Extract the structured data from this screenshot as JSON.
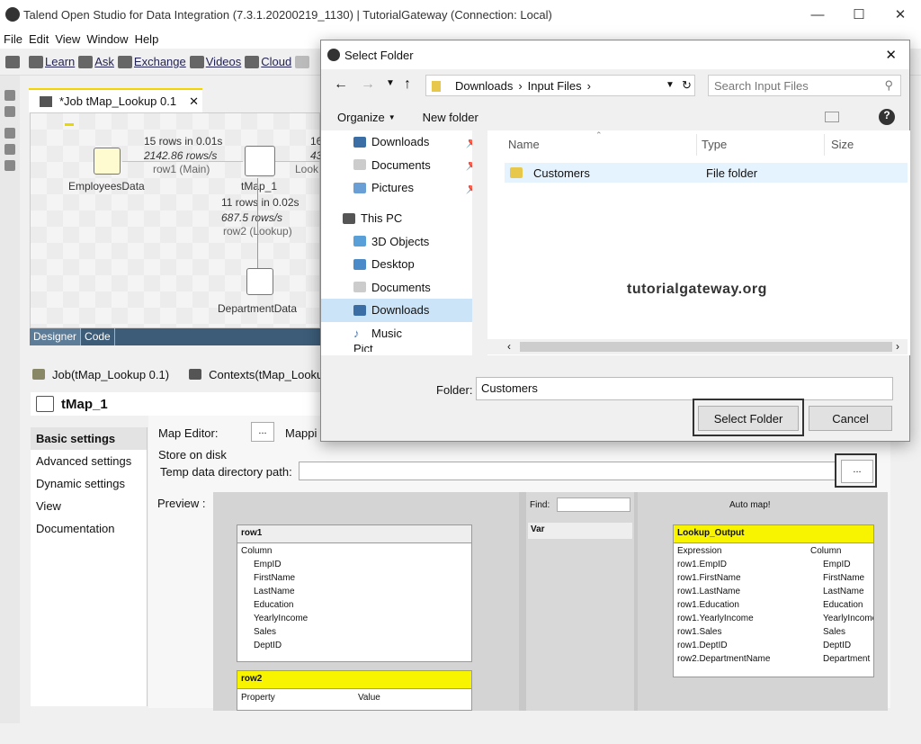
{
  "app": {
    "title": "Talend Open Studio for Data Integration (7.3.1.20200219_1130) | TutorialGateway (Connection: Local)",
    "menu": [
      "File",
      "Edit",
      "View",
      "Window",
      "Help"
    ],
    "toolbar": [
      "Learn",
      "Ask",
      "Exchange",
      "Videos",
      "Cloud"
    ]
  },
  "editor": {
    "tab_label": "*Job tMap_Lookup 0.1",
    "nodes": {
      "employees": "EmployeesData",
      "tmap": "tMap_1",
      "department": "DepartmentData"
    },
    "flows": {
      "main_stats": "15 rows in 0.01s",
      "main_rate": "2142.86 rows/s",
      "main_label": "row1 (Main)",
      "lookup_stats": "11 rows in 0.02s",
      "lookup_rate": "687.5 rows/s",
      "lookup_label": "row2 (Lookup)",
      "out_stats": "16",
      "out_rate": "43",
      "out_label": "Look"
    },
    "bottom_tabs": [
      "Designer",
      "Code"
    ]
  },
  "component_panel": {
    "job_tab": "Job(tMap_Lookup 0.1)",
    "contexts_tab": "Contexts(tMap_Looku",
    "title": "tMap_1",
    "left_tabs": [
      "Basic settings",
      "Advanced settings",
      "Dynamic settings",
      "View",
      "Documentation"
    ],
    "map_editor_label": "Map Editor:",
    "map_editor_btn": "...",
    "mapping_label": "Mappi",
    "store_label": "Store on disk",
    "temp_label": "Temp data directory path:",
    "temp_btn": "...",
    "preview_label": "Preview :"
  },
  "preview": {
    "row1": {
      "title": "row1",
      "header": "Column",
      "columns": [
        "EmpID",
        "FirstName",
        "LastName",
        "Education",
        "YearlyIncome",
        "Sales",
        "DeptID"
      ]
    },
    "row2": {
      "title": "row2",
      "col1": "Property",
      "col2": "Value"
    },
    "var": {
      "title": "Var",
      "find_label": "Find:"
    },
    "output": {
      "auto_map": "Auto map!",
      "title": "Lookup_Output",
      "expr_header": "Expression",
      "col_header": "Column",
      "expressions": [
        "row1.EmpID",
        "row1.FirstName",
        "row1.LastName",
        "row1.Education",
        "row1.YearlyIncome",
        "row1.Sales",
        "row1.DeptID",
        "row2.DepartmentName"
      ],
      "columns": [
        "EmpID",
        "FirstName",
        "LastName",
        "Education",
        "YearlyIncome",
        "Sales",
        "DeptID",
        "Department"
      ]
    }
  },
  "dialog": {
    "title": "Select Folder",
    "path": [
      "Downloads",
      "Input Files"
    ],
    "search_placeholder": "Search Input Files",
    "organize": "Organize",
    "new_folder": "New folder",
    "nav_quick": [
      "Downloads",
      "Documents",
      "Pictures"
    ],
    "this_pc": "This PC",
    "nav_pc": [
      "3D Objects",
      "Desktop",
      "Documents",
      "Downloads",
      "Music",
      "Pict"
    ],
    "columns": {
      "name": "Name",
      "type": "Type",
      "size": "Size"
    },
    "files": [
      {
        "name": "Customers",
        "type": "File folder"
      }
    ],
    "watermark": "tutorialgateway.org",
    "folder_label": "Folder:",
    "folder_value": "Customers",
    "select_button": "Select Folder",
    "cancel_button": "Cancel"
  }
}
